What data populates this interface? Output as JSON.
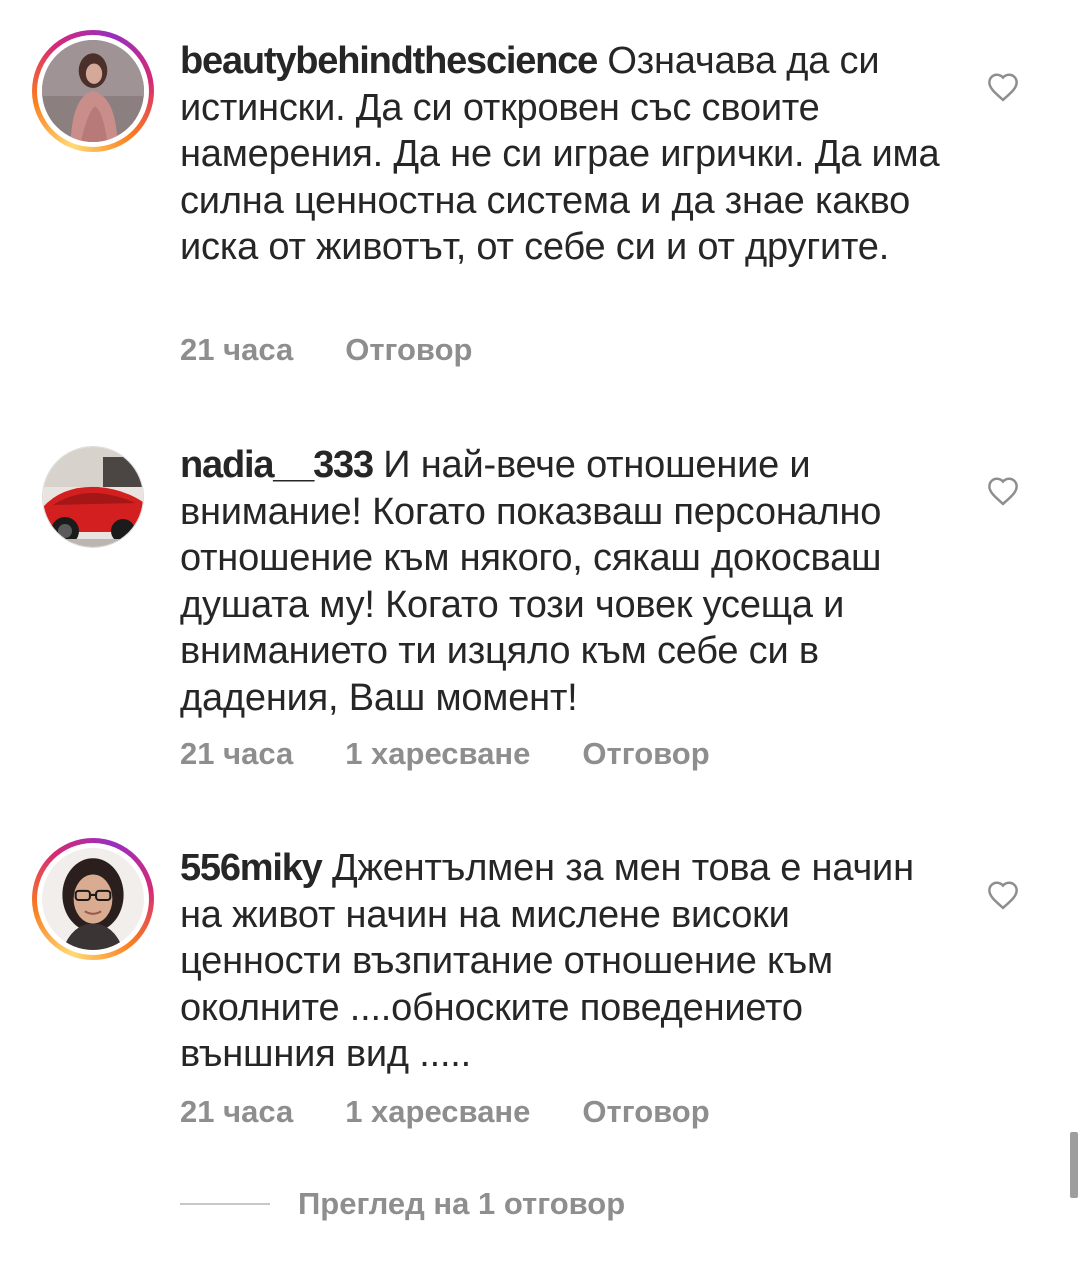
{
  "comments": [
    {
      "username": "beautybehindthescience",
      "text": "Означава да си истински. Да си откровен със своите намерения. Да не си играе игрички. Да има силна ценностна система и да знае какво иска от животът, от себе си и от другите.",
      "time": "21 часа",
      "likes": "",
      "reply_label": "Отговор",
      "avatar": "woman-in-pink-top-photo",
      "has_story_ring": true
    },
    {
      "username": "nadia__333",
      "text": "И най-вече отношение и внимание! Когато показваш персонално отношение към някого, сякаш докосваш душата му! Когато този човек усеща и вниманието ти изцяло към себе си в дадения, Ваш момент!",
      "time": "21 часа",
      "likes": "1 харесване",
      "reply_label": "Отговор",
      "avatar": "red-sports-car-photo",
      "has_story_ring": false
    },
    {
      "username": "556miky",
      "text": "Джентълмен за мен това е начин на живот начин на мислене високи ценности възпитание  отношение към околните ....обноските поведението външния вид .....",
      "time": "21 часа",
      "likes": "1 харесване",
      "reply_label": "Отговор",
      "avatar": "woman-with-glasses-photo",
      "has_story_ring": true
    }
  ],
  "view_replies_label": "Преглед на 1 отговор",
  "colors": {
    "text": "#262626",
    "meta": "#8e8e8e",
    "ring_start": "#feda75",
    "ring_mid": "#d62976",
    "ring_end": "#962fbf"
  },
  "icons": {
    "like": "heart-outline-icon"
  }
}
